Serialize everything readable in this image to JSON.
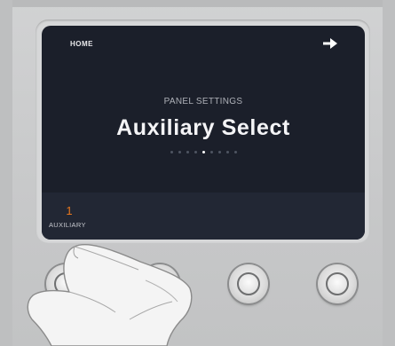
{
  "screen": {
    "home_label": "HOME",
    "forward_icon": "arrow-right-icon",
    "section_title": "PANEL SETTINGS",
    "page_title": "Auxiliary Select",
    "pagination": {
      "total": 9,
      "active_index": 4
    }
  },
  "soft_button": {
    "number": "1",
    "label": "AUXILIARY"
  },
  "colors": {
    "screen_bg": "#1b1f2a",
    "accent": "#e8771d",
    "text": "#f4f4f6"
  }
}
